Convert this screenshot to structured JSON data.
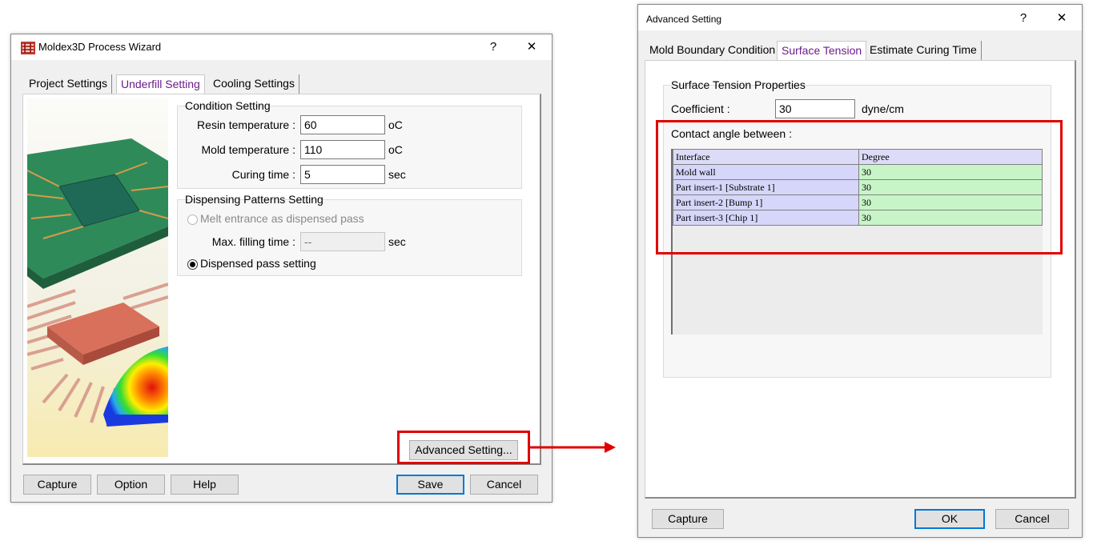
{
  "wizard": {
    "title": "Moldex3D Process Wizard",
    "help_glyph": "?",
    "close_glyph": "✕",
    "tabs": [
      {
        "label": "Project Settings"
      },
      {
        "label": "Underfill Setting"
      },
      {
        "label": "Cooling Settings"
      }
    ],
    "condition": {
      "title": "Condition Setting",
      "resin_label": "Resin temperature :",
      "resin_value": "60",
      "resin_unit": "oC",
      "mold_label": "Mold temperature :",
      "mold_value": "110",
      "mold_unit": "oC",
      "curing_label": "Curing time :",
      "curing_value": "5",
      "curing_unit": "sec"
    },
    "dispensing": {
      "title": "Dispensing Patterns Setting",
      "melt_label": "Melt entrance as dispensed pass",
      "max_label": "Max. filling time :",
      "max_value": "--",
      "max_unit": "sec",
      "dispensed_label": "Dispensed pass setting"
    },
    "advanced_button": "Advanced Setting...",
    "buttons": {
      "capture": "Capture",
      "option": "Option",
      "help": "Help",
      "save": "Save",
      "cancel": "Cancel"
    }
  },
  "advanced": {
    "title": "Advanced Setting",
    "help_glyph": "?",
    "close_glyph": "✕",
    "tabs": [
      {
        "label": "Mold Boundary Condition"
      },
      {
        "label": "Surface Tension"
      },
      {
        "label": "Estimate Curing Time"
      }
    ],
    "surface": {
      "title": "Surface Tension Properties",
      "coef_label": "Coefficient :",
      "coef_value": "30",
      "coef_unit": "dyne/cm",
      "contact_label": "Contact angle between :"
    },
    "table": {
      "headers": [
        "Interface",
        "Degree"
      ],
      "rows": [
        {
          "interface": "Mold wall",
          "degree": "30"
        },
        {
          "interface": "Part insert-1 [Substrate 1]",
          "degree": "30"
        },
        {
          "interface": "Part insert-2 [Bump 1]",
          "degree": "30"
        },
        {
          "interface": "Part insert-3 [Chip 1]",
          "degree": "30"
        }
      ]
    },
    "buttons": {
      "capture": "Capture",
      "ok": "OK",
      "cancel": "Cancel"
    }
  },
  "colors": {
    "highlight": "#e00000",
    "active_tab_text": "#6b1b8e",
    "degree_cell": "#c8f5c8",
    "interface_cell": "#d6d6fa"
  }
}
